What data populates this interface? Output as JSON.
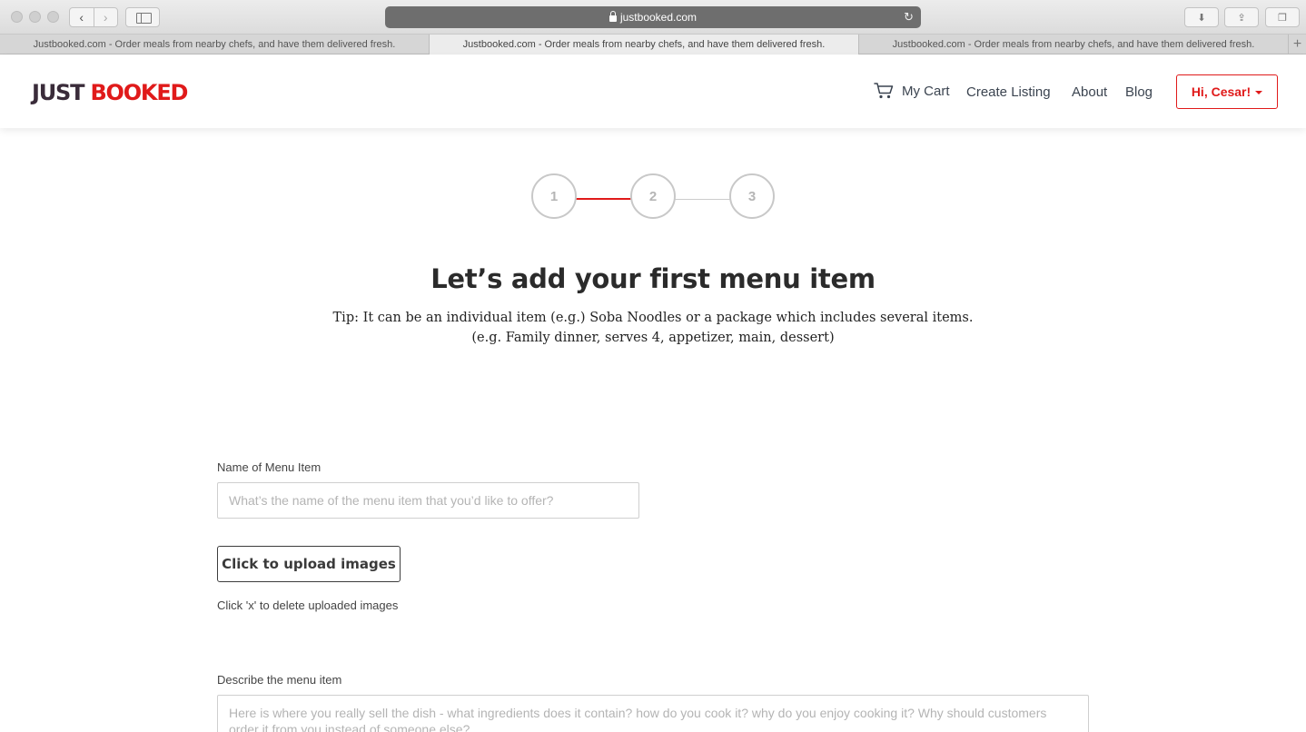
{
  "browser": {
    "url": "justbooked.com",
    "tabs": [
      {
        "label": "Justbooked.com - Order meals from nearby chefs, and have them delivered fresh."
      },
      {
        "label": "Justbooked.com - Order meals from nearby chefs, and have them delivered fresh."
      },
      {
        "label": "Justbooked.com - Order meals from nearby chefs, and have them delivered fresh."
      }
    ]
  },
  "header": {
    "logo_just": "JUST",
    "logo_booked": "BOOKED",
    "nav": {
      "cart": "My Cart",
      "create_listing": "Create Listing",
      "about": "About",
      "blog": "Blog"
    },
    "user_menu": "Hi, Cesar!"
  },
  "stepper": {
    "steps": [
      "1",
      "2",
      "3"
    ],
    "active_line_color": "#e01a1a",
    "inactive_line_color": "#cccccc"
  },
  "main": {
    "title": "Let’s add your first menu item",
    "tip": "Tip: It can be an individual item (e.g.) Soba Noodles or a package which includes several items. (e.g. Family dinner, serves 4, appetizer, main, dessert)",
    "name_label": "Name of Menu Item",
    "name_placeholder": "What’s the name of the menu item that you’d like to offer?",
    "upload_label": "Click to upload images",
    "upload_hint": "Click 'x' to delete uploaded images",
    "describe_label": "Describe the menu item",
    "describe_placeholder": "Here is where you really sell the dish - what ingredients does it contain? how do you cook it? why do you enjoy cooking it? Why should customers order it from you instead of someone else?"
  },
  "colors": {
    "brand_red": "#e01a1a",
    "logo_dark": "#3a2c3a"
  }
}
